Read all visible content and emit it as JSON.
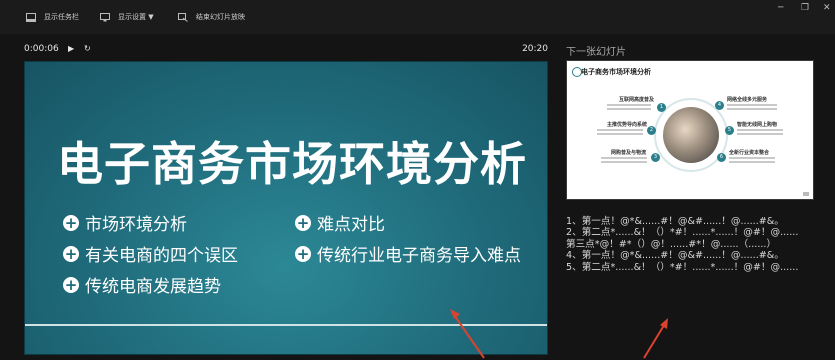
{
  "toolbar": {
    "show_taskbar": "显示任务栏",
    "display_settings": "显示设置 ▼",
    "end_show": "结束幻灯片放映",
    "win_min": "─",
    "win_restore": "❐",
    "win_close": "✕"
  },
  "timer": {
    "elapsed": "0:00:06",
    "play_icon": "▶",
    "restart_icon": "↻",
    "clock": "20:20"
  },
  "slide": {
    "title": "电子商务市场环境分析",
    "bullets_left": [
      "市场环境分析",
      "有关电商的四个误区",
      "传统电商发展趋势"
    ],
    "bullets_right": [
      "难点对比",
      "传统行业电子商务导入难点"
    ]
  },
  "next_slide": {
    "label": "下一张幻灯片",
    "thumb_title": "电子商务市场环境分析",
    "heads": [
      "互联网高度普及",
      "主推优势导向系统",
      "网购普及与物流",
      "网络全线多元服务",
      "智能无线网上购物",
      "全新行业资本整合"
    ]
  },
  "notes": [
    "1、第一点！@*&......#！@&#......！@......#&。",
    "2、第二点*......&！（）*#！......*......！@#！@......",
    "第三点*@！#*（）@！......#*！@......（......）",
    "4、第一点！@*&......#！@&#......！@......#&。",
    "5、第二点*......&！（）*#！......*......！@#！@......"
  ],
  "colors": {
    "accent": "#2a7f8a",
    "slide_bg": "#1f6a7a",
    "arrow": "#d9432f"
  }
}
